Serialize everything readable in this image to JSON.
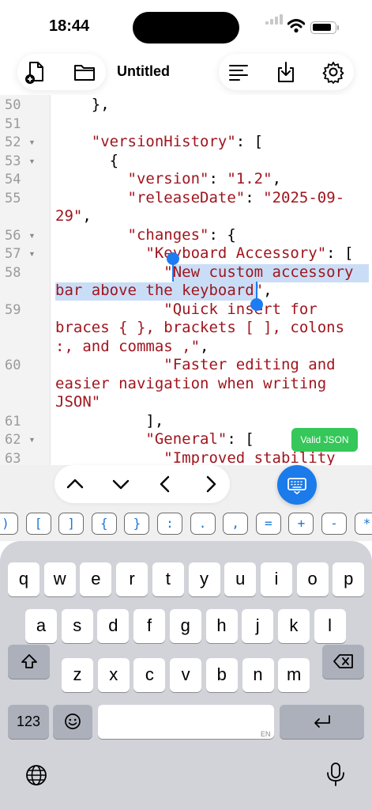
{
  "status_bar": {
    "time": "18:44",
    "battery_level": 0.88
  },
  "toolbar": {
    "title": "Untitled"
  },
  "editor": {
    "lines": [
      {
        "num": "50",
        "fold": false,
        "segments": [
          [
            "    },",
            "p"
          ]
        ]
      },
      {
        "num": "51",
        "fold": false,
        "segments": []
      },
      {
        "num": "52",
        "fold": true,
        "segments": [
          [
            "    ",
            "p"
          ],
          [
            "\"versionHistory\"",
            "s"
          ],
          [
            ": [",
            "p"
          ]
        ]
      },
      {
        "num": "53",
        "fold": true,
        "segments": [
          [
            "      {",
            "p"
          ]
        ]
      },
      {
        "num": "54",
        "fold": false,
        "segments": [
          [
            "        ",
            "p"
          ],
          [
            "\"version\"",
            "s"
          ],
          [
            ": ",
            "p"
          ],
          [
            "\"1.2\"",
            "s"
          ],
          [
            ",",
            "p"
          ]
        ]
      },
      {
        "num": "55",
        "fold": false,
        "segments": [
          [
            "        ",
            "p"
          ],
          [
            "\"releaseDate\"",
            "s"
          ],
          [
            ": ",
            "p"
          ],
          [
            "\"2025-09-",
            "s"
          ]
        ]
      },
      {
        "num": "",
        "fold": false,
        "segments": [
          [
            "29\"",
            "s"
          ],
          [
            ",",
            "p"
          ]
        ]
      },
      {
        "num": "56",
        "fold": true,
        "segments": [
          [
            "        ",
            "p"
          ],
          [
            "\"changes\"",
            "s"
          ],
          [
            ": {",
            "p"
          ]
        ]
      },
      {
        "num": "57",
        "fold": true,
        "segments": [
          [
            "          ",
            "p"
          ],
          [
            "\"Keyboard Accessory\"",
            "s"
          ],
          [
            ": [",
            "p"
          ]
        ]
      },
      {
        "num": "58",
        "fold": false,
        "segments": [
          [
            "            ",
            "p"
          ],
          [
            "\"New custom accessory",
            "s"
          ]
        ]
      },
      {
        "num": "",
        "fold": false,
        "segments": [
          [
            "bar above the keyboard\"",
            "s"
          ],
          [
            ",",
            "p"
          ]
        ]
      },
      {
        "num": "59",
        "fold": false,
        "segments": [
          [
            "            ",
            "p"
          ],
          [
            "\"Quick insert for",
            "s"
          ]
        ]
      },
      {
        "num": "",
        "fold": false,
        "segments": [
          [
            "braces { }, brackets [ ], colons",
            "s"
          ]
        ]
      },
      {
        "num": "",
        "fold": false,
        "segments": [
          [
            ":, and commas ,\"",
            "s"
          ],
          [
            ",",
            "p"
          ]
        ]
      },
      {
        "num": "60",
        "fold": false,
        "segments": [
          [
            "            ",
            "p"
          ],
          [
            "\"Faster editing and",
            "s"
          ]
        ]
      },
      {
        "num": "",
        "fold": false,
        "segments": [
          [
            "easier navigation when writing",
            "s"
          ]
        ]
      },
      {
        "num": "",
        "fold": false,
        "segments": [
          [
            "JSON\"",
            "s"
          ]
        ]
      },
      {
        "num": "61",
        "fold": false,
        "segments": [
          [
            "          ],",
            "p"
          ]
        ]
      },
      {
        "num": "62",
        "fold": true,
        "segments": [
          [
            "          ",
            "p"
          ],
          [
            "\"General\"",
            "s"
          ],
          [
            ": [",
            "p"
          ]
        ]
      },
      {
        "num": "63",
        "fold": false,
        "segments": [
          [
            "            ",
            "p"
          ],
          [
            "\"Improved stability",
            "s"
          ]
        ]
      }
    ],
    "validation_badge": "Valid JSON"
  },
  "accessory": {
    "nav_buttons": [
      "chevron-up-icon",
      "chevron-down-icon",
      "chevron-left-icon",
      "chevron-right-icon"
    ],
    "insert_keys": [
      ")",
      "[",
      "]",
      "{",
      "}",
      ":",
      ".",
      ",",
      "=",
      "+",
      "-",
      "*"
    ]
  },
  "keyboard": {
    "row1": [
      "q",
      "w",
      "e",
      "r",
      "t",
      "y",
      "u",
      "i",
      "o",
      "p"
    ],
    "row2": [
      "a",
      "s",
      "d",
      "f",
      "g",
      "h",
      "j",
      "k",
      "l"
    ],
    "row3": [
      "z",
      "x",
      "c",
      "v",
      "b",
      "n",
      "m"
    ],
    "numbers_key": "123",
    "space_hint": "EN",
    "colors": {
      "accent": "#1b7bea",
      "valid": "#35c759",
      "string": "#a0151e"
    }
  }
}
